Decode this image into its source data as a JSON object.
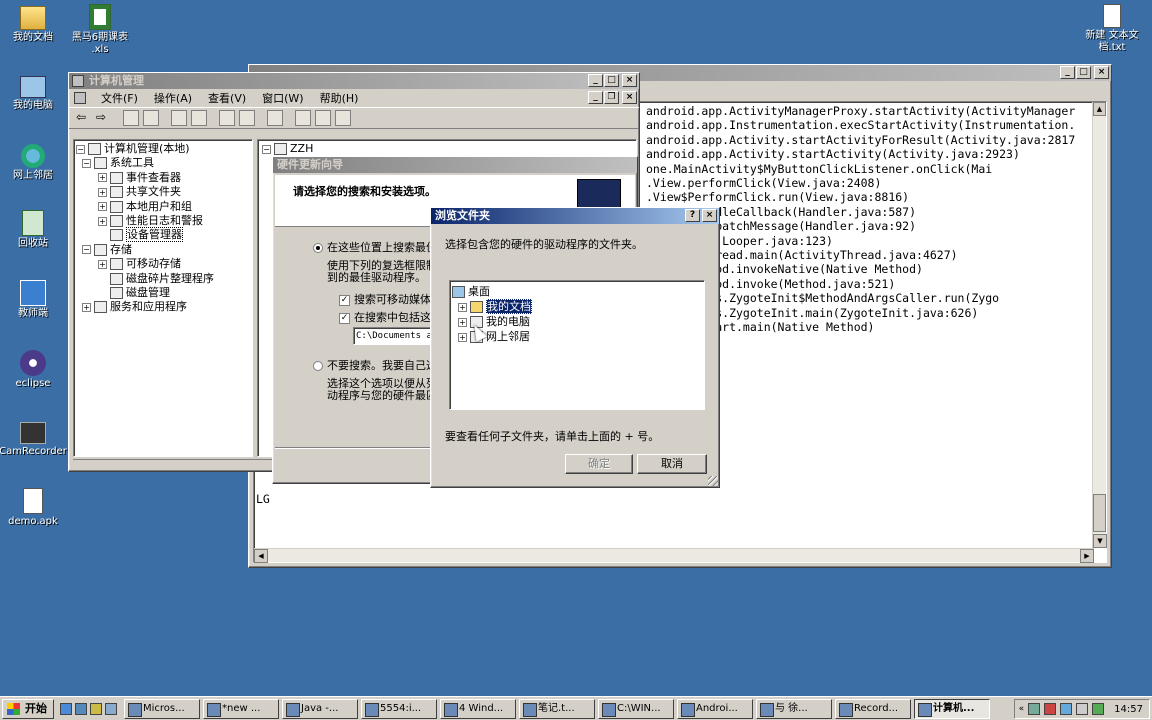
{
  "desktop_icons": [
    {
      "name": "我的文档",
      "icon": "my-documents-icon"
    },
    {
      "name": "我的电脑",
      "icon": "my-computer-icon"
    },
    {
      "name": "网上邻居",
      "icon": "network-icon"
    },
    {
      "name": "回收站",
      "icon": "recycle-bin-icon"
    },
    {
      "name": "教师端",
      "icon": "teacher-icon"
    },
    {
      "name": "eclipse",
      "icon": "eclipse-icon"
    },
    {
      "name": "CamRecorder",
      "icon": "camrecorder-icon"
    },
    {
      "name": "demo.apk",
      "icon": "apk-file-icon"
    }
  ],
  "desktop_file_xls": {
    "line1": "黑马6期课表",
    "line2": ".xls"
  },
  "desktop_file_txt": {
    "line1": "新建 文本文",
    "line2": "档.txt"
  },
  "cm_window": {
    "title": "计算机管理",
    "menu": [
      "文件(F)",
      "操作(A)",
      "查看(V)",
      "窗口(W)",
      "帮助(H)"
    ],
    "tree": [
      {
        "label": "计算机管理(本地)"
      },
      {
        "label": "系统工具"
      },
      {
        "label": "事件查看器"
      },
      {
        "label": "共享文件夹"
      },
      {
        "label": "本地用户和组"
      },
      {
        "label": "性能日志和警报"
      },
      {
        "label": "设备管理器"
      },
      {
        "label": "存储"
      },
      {
        "label": "可移动存储"
      },
      {
        "label": "磁盘碎片整理程序"
      },
      {
        "label": "磁盘管理"
      },
      {
        "label": "服务和应用程序"
      }
    ],
    "right_node": "ZZH"
  },
  "console_window": {
    "lines": [
      "android.app.ActivityManagerProxy.startActivity(ActivityManager",
      "android.app.Instrumentation.execStartActivity(Instrumentation.",
      "android.app.Activity.startActivityForResult(Activity.java:2817",
      "android.app.Activity.startActivity(Activity.java:2923)",
      "one.MainActivity$MyButtonClickListener.onClick(Mai",
      ".View.performClick(View.java:2408)",
      ".View$PerformClick.run(View.java:8816)",
      "andler.handleCallback(Handler.java:587)",
      "andler.dispatchMessage(Handler.java:92)",
      "ooper.loop(Looper.java:123)",
      "ActivityThread.main(ActivityThread.java:4627)",
      "flect.Method.invokeNative(Native Method)",
      "flect.Method.invoke(Method.java:521)",
      "internal.os.ZygoteInit$MethodAndArgsCaller.run(Zygo",
      "internal.os.ZygoteInit.main(ZygoteInit.java:626)",
      "n.NativeStart.main(Native Method)",
      ">"
    ],
    "bottom_text": "LG"
  },
  "wizard": {
    "title": "硬件更新向导",
    "header": "请选择您的搜索和安装选项。",
    "radio1": "在这些位置上搜索最佳",
    "radio1_desc1": "使用下列的复选框限制",
    "radio1_desc2": "到的最佳驱动程序。",
    "check1": "搜索可移动媒体",
    "check2": "在搜索中包括这",
    "path_value": "C:\\Documents a",
    "radio2": "不要搜索。我要自己选",
    "radio2_desc1": "选择这个选项以便从列",
    "radio2_desc2": "动程序与您的硬件最匹"
  },
  "browse_dialog": {
    "title": "浏览文件夹",
    "instruction": "选择包含您的硬件的驱动程序的文件夹。",
    "tree": [
      {
        "label": "桌面"
      },
      {
        "label": "我的文档"
      },
      {
        "label": "我的电脑"
      },
      {
        "label": "网上邻居"
      }
    ],
    "hint": "要查看任何子文件夹，请单击上面的 + 号。",
    "ok": "确定",
    "cancel": "取消"
  },
  "taskbar": {
    "start": "开始",
    "tasks": [
      "Micros...",
      "*new ...",
      "Java -...",
      "5554:i...",
      "4 Wind...",
      "笔记.t...",
      "C:\\WIN...",
      "Androi...",
      "与 徐...",
      "Record...",
      "计算机..."
    ],
    "clock": "14:57"
  },
  "colors": {
    "desktop": "#3a6ea5",
    "title_active": "#0a246a",
    "window_face": "#d4d0c8",
    "selection": "#0a246a"
  }
}
